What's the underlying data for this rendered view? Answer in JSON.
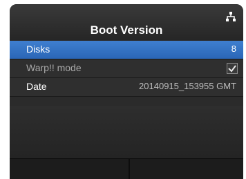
{
  "screen": {
    "title": "Boot Version",
    "status_icon": "network-icon"
  },
  "items": [
    {
      "label": "Disks",
      "value": "8"
    },
    {
      "label": "Warp!! mode",
      "value": "",
      "icon": "check-icon"
    },
    {
      "label": "Date",
      "value": "20140915_153955 GMT"
    }
  ],
  "colors": {
    "selection": "#3a78c8",
    "background": "#2b2b2b",
    "text": "#ffffff"
  }
}
